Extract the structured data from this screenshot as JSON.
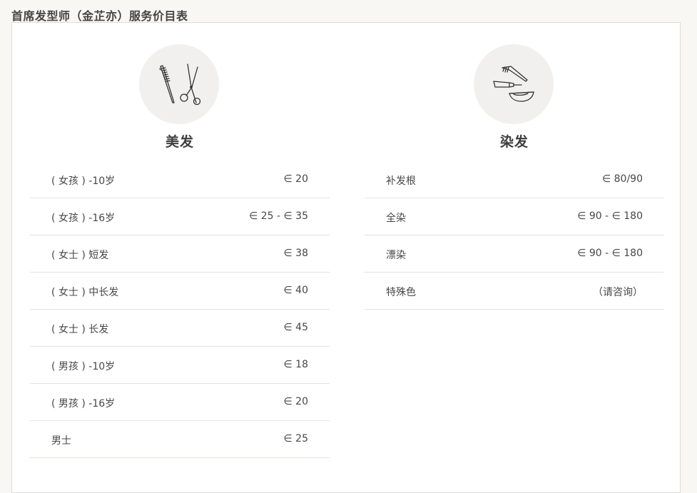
{
  "page": {
    "title": "首席发型师（金芷亦）服务价目表"
  },
  "sections": [
    {
      "title": "美发",
      "icon": "comb-scissors-icon",
      "items": [
        {
          "name": "( 女孩 ) -10岁",
          "price": "∈ 20"
        },
        {
          "name": "( 女孩 ) -16岁",
          "price": "∈ 25 - ∈ 35"
        },
        {
          "name": "( 女士 ) 短发",
          "price": "∈ 38"
        },
        {
          "name": "( 女士 ) 中长发",
          "price": "∈ 40"
        },
        {
          "name": "( 女士 ) 长发",
          "price": "∈ 45"
        },
        {
          "name": "( 男孩 ) -10岁",
          "price": "∈ 18"
        },
        {
          "name": "( 男孩 ) -16岁",
          "price": "∈ 20"
        },
        {
          "name": "男士",
          "price": "∈ 25"
        }
      ]
    },
    {
      "title": "染发",
      "icon": "dye-brush-bowl-icon",
      "items": [
        {
          "name": "补发根",
          "price": "∈ 80/90"
        },
        {
          "name": "全染",
          "price": "∈ 90 - ∈ 180"
        },
        {
          "name": "漂染",
          "price": "∈ 90 - ∈ 180"
        },
        {
          "name": "特殊色",
          "price": "（请咨询）"
        }
      ]
    }
  ]
}
